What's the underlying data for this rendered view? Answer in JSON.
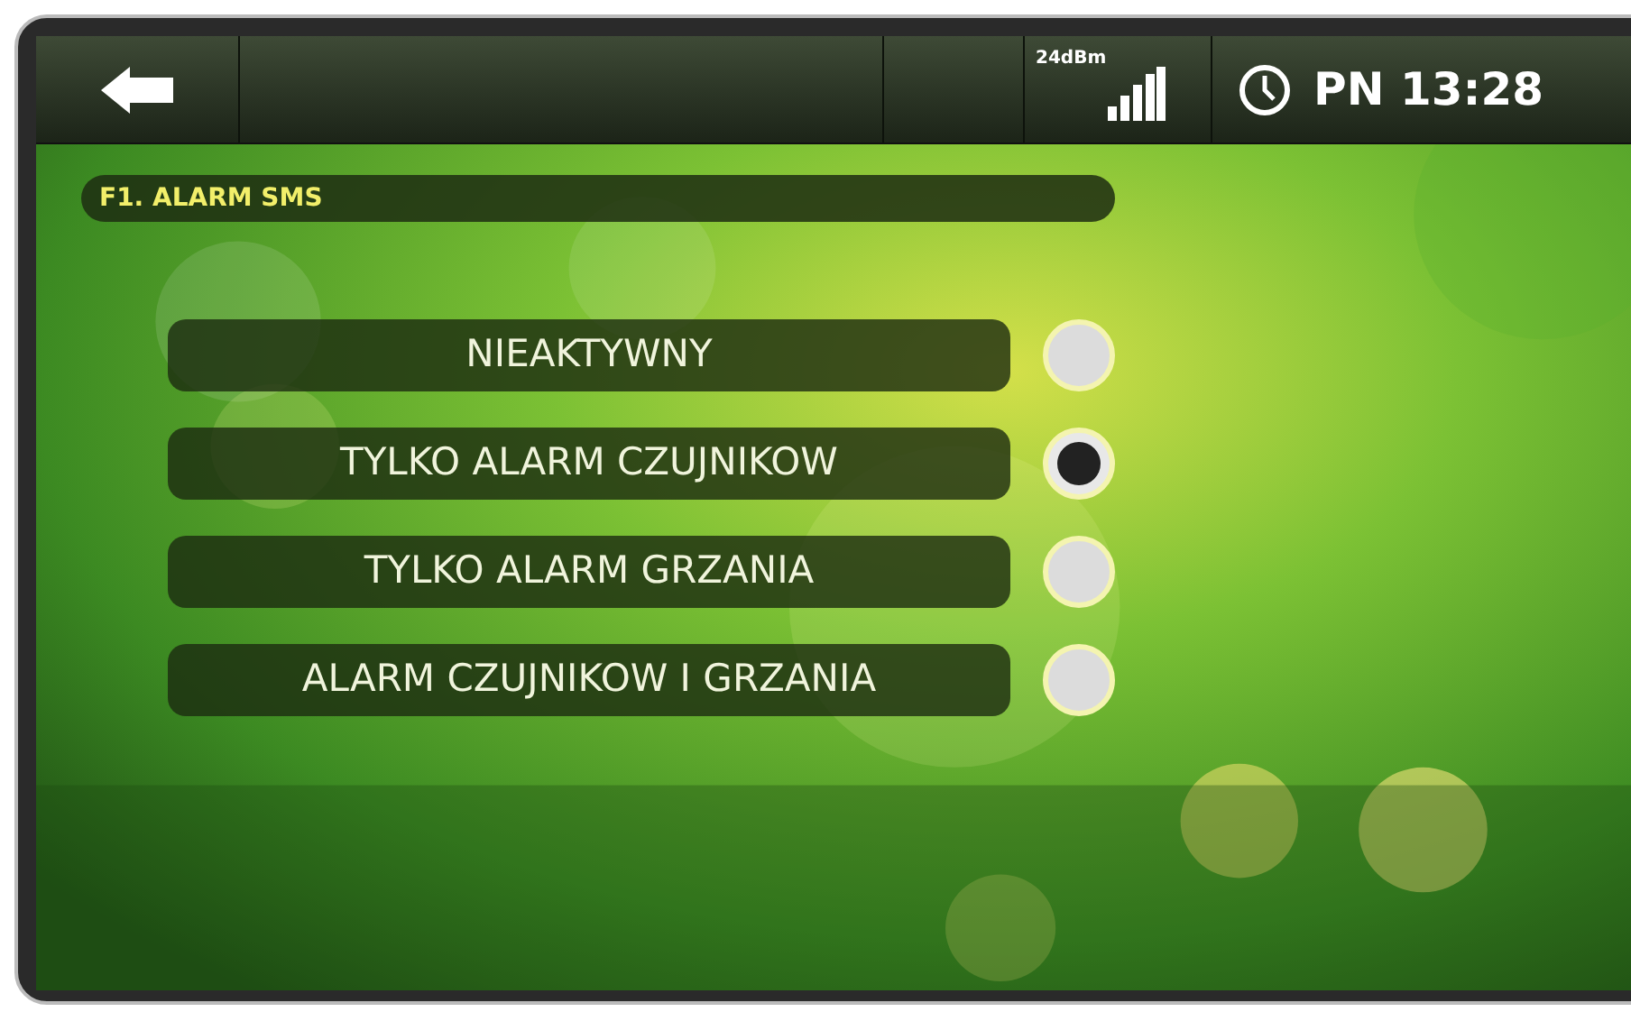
{
  "top_bar": {
    "signal_label": "24dBm",
    "clock": "PN 13:28"
  },
  "title": "F1. ALARM SMS",
  "options": [
    {
      "label": "NIEAKTYWNY",
      "selected": false
    },
    {
      "label": "TYLKO ALARM CZUJNIKOW",
      "selected": true
    },
    {
      "label": "TYLKO ALARM GRZANIA",
      "selected": false
    },
    {
      "label": "ALARM CZUJNIKOW I GRZANIA",
      "selected": false
    }
  ]
}
